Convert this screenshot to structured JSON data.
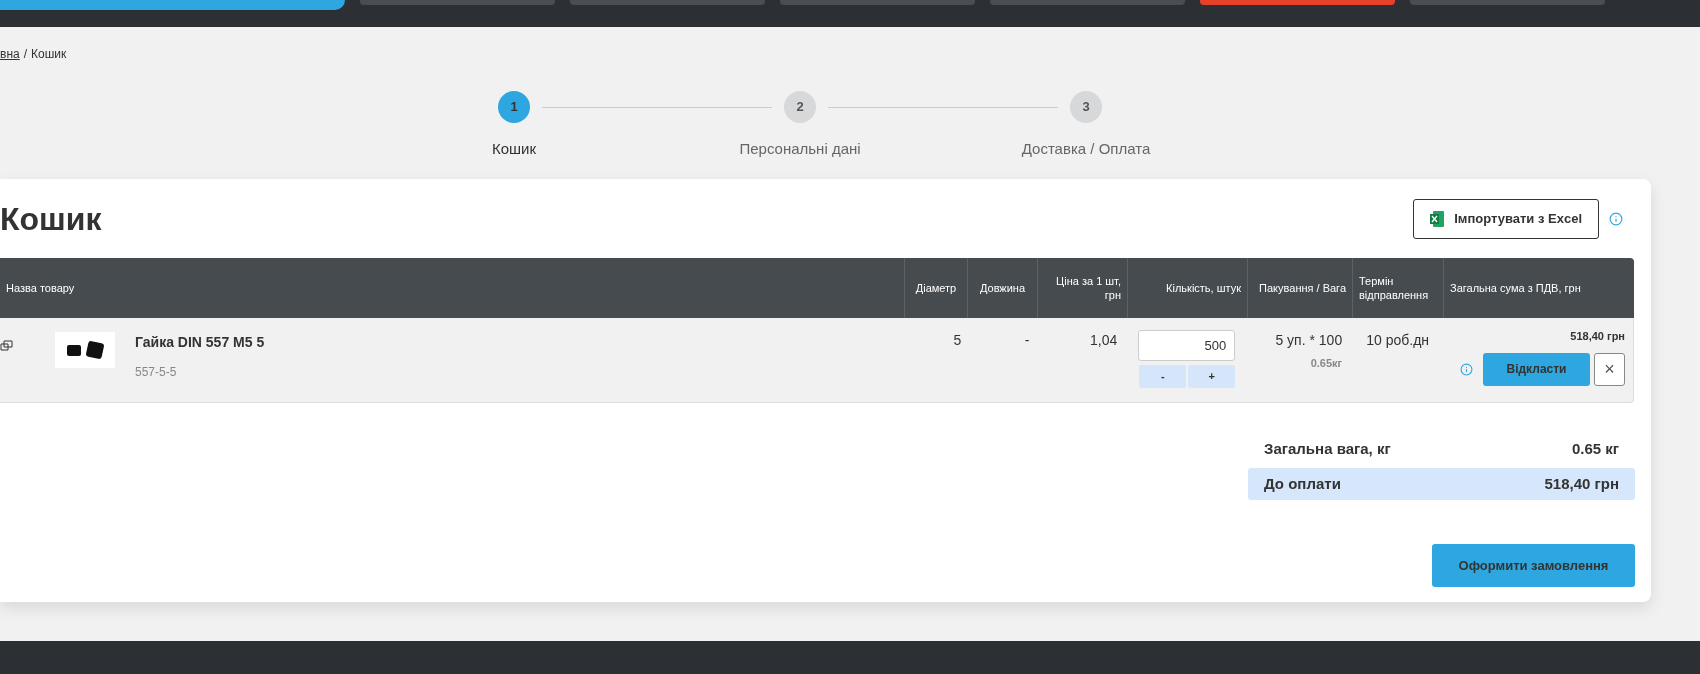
{
  "top_nav": {
    "tabs": [
      {
        "kind": "catalog"
      },
      {
        "kind": "tab",
        "selected": false
      },
      {
        "kind": "tab",
        "selected": false
      },
      {
        "kind": "tab",
        "selected": false
      },
      {
        "kind": "tab",
        "selected": false
      },
      {
        "kind": "tab",
        "selected": true
      },
      {
        "kind": "tab",
        "selected": false
      }
    ]
  },
  "breadcrumb": {
    "links": [
      "вна"
    ],
    "separator": "/",
    "current": "Кошик"
  },
  "steps": [
    {
      "number": "1",
      "label": "Кошик",
      "selected": true
    },
    {
      "number": "2",
      "label": "Персональні дані",
      "selected": false
    },
    {
      "number": "3",
      "label": "Доставка / Оплата",
      "selected": false
    }
  ],
  "cart": {
    "title": "Кошик",
    "import_button": "Імпортувати з Excel",
    "table": {
      "columns": [
        "Назва товару",
        "Діаметр",
        "Довжина",
        "Ціна за 1 шт, грн",
        "Кількість, штук",
        "Пакування / Вага",
        "Термін відправлення",
        "Загальна сума з ПДВ, грн"
      ],
      "rows": [
        {
          "name": "Гайка DIN 557 M5 5",
          "code": "557-5-5",
          "diameter": "5",
          "length": "-",
          "price": "1,04",
          "quantity": "500",
          "minus": "-",
          "plus": "+",
          "packing": "5 уп. * 100",
          "weight": "0.65кг",
          "term": "10 роб.дн",
          "total": "518,40 грн",
          "postpone_button": "Відкласти",
          "remove": "×"
        }
      ]
    },
    "summary": [
      {
        "label": "Загальна вага, кг",
        "value": "0.65 кг",
        "highlighted": false
      },
      {
        "label": "До оплати",
        "value": "518,40 грн",
        "highlighted": true
      }
    ],
    "checkout_button": "Оформити замовлення"
  }
}
